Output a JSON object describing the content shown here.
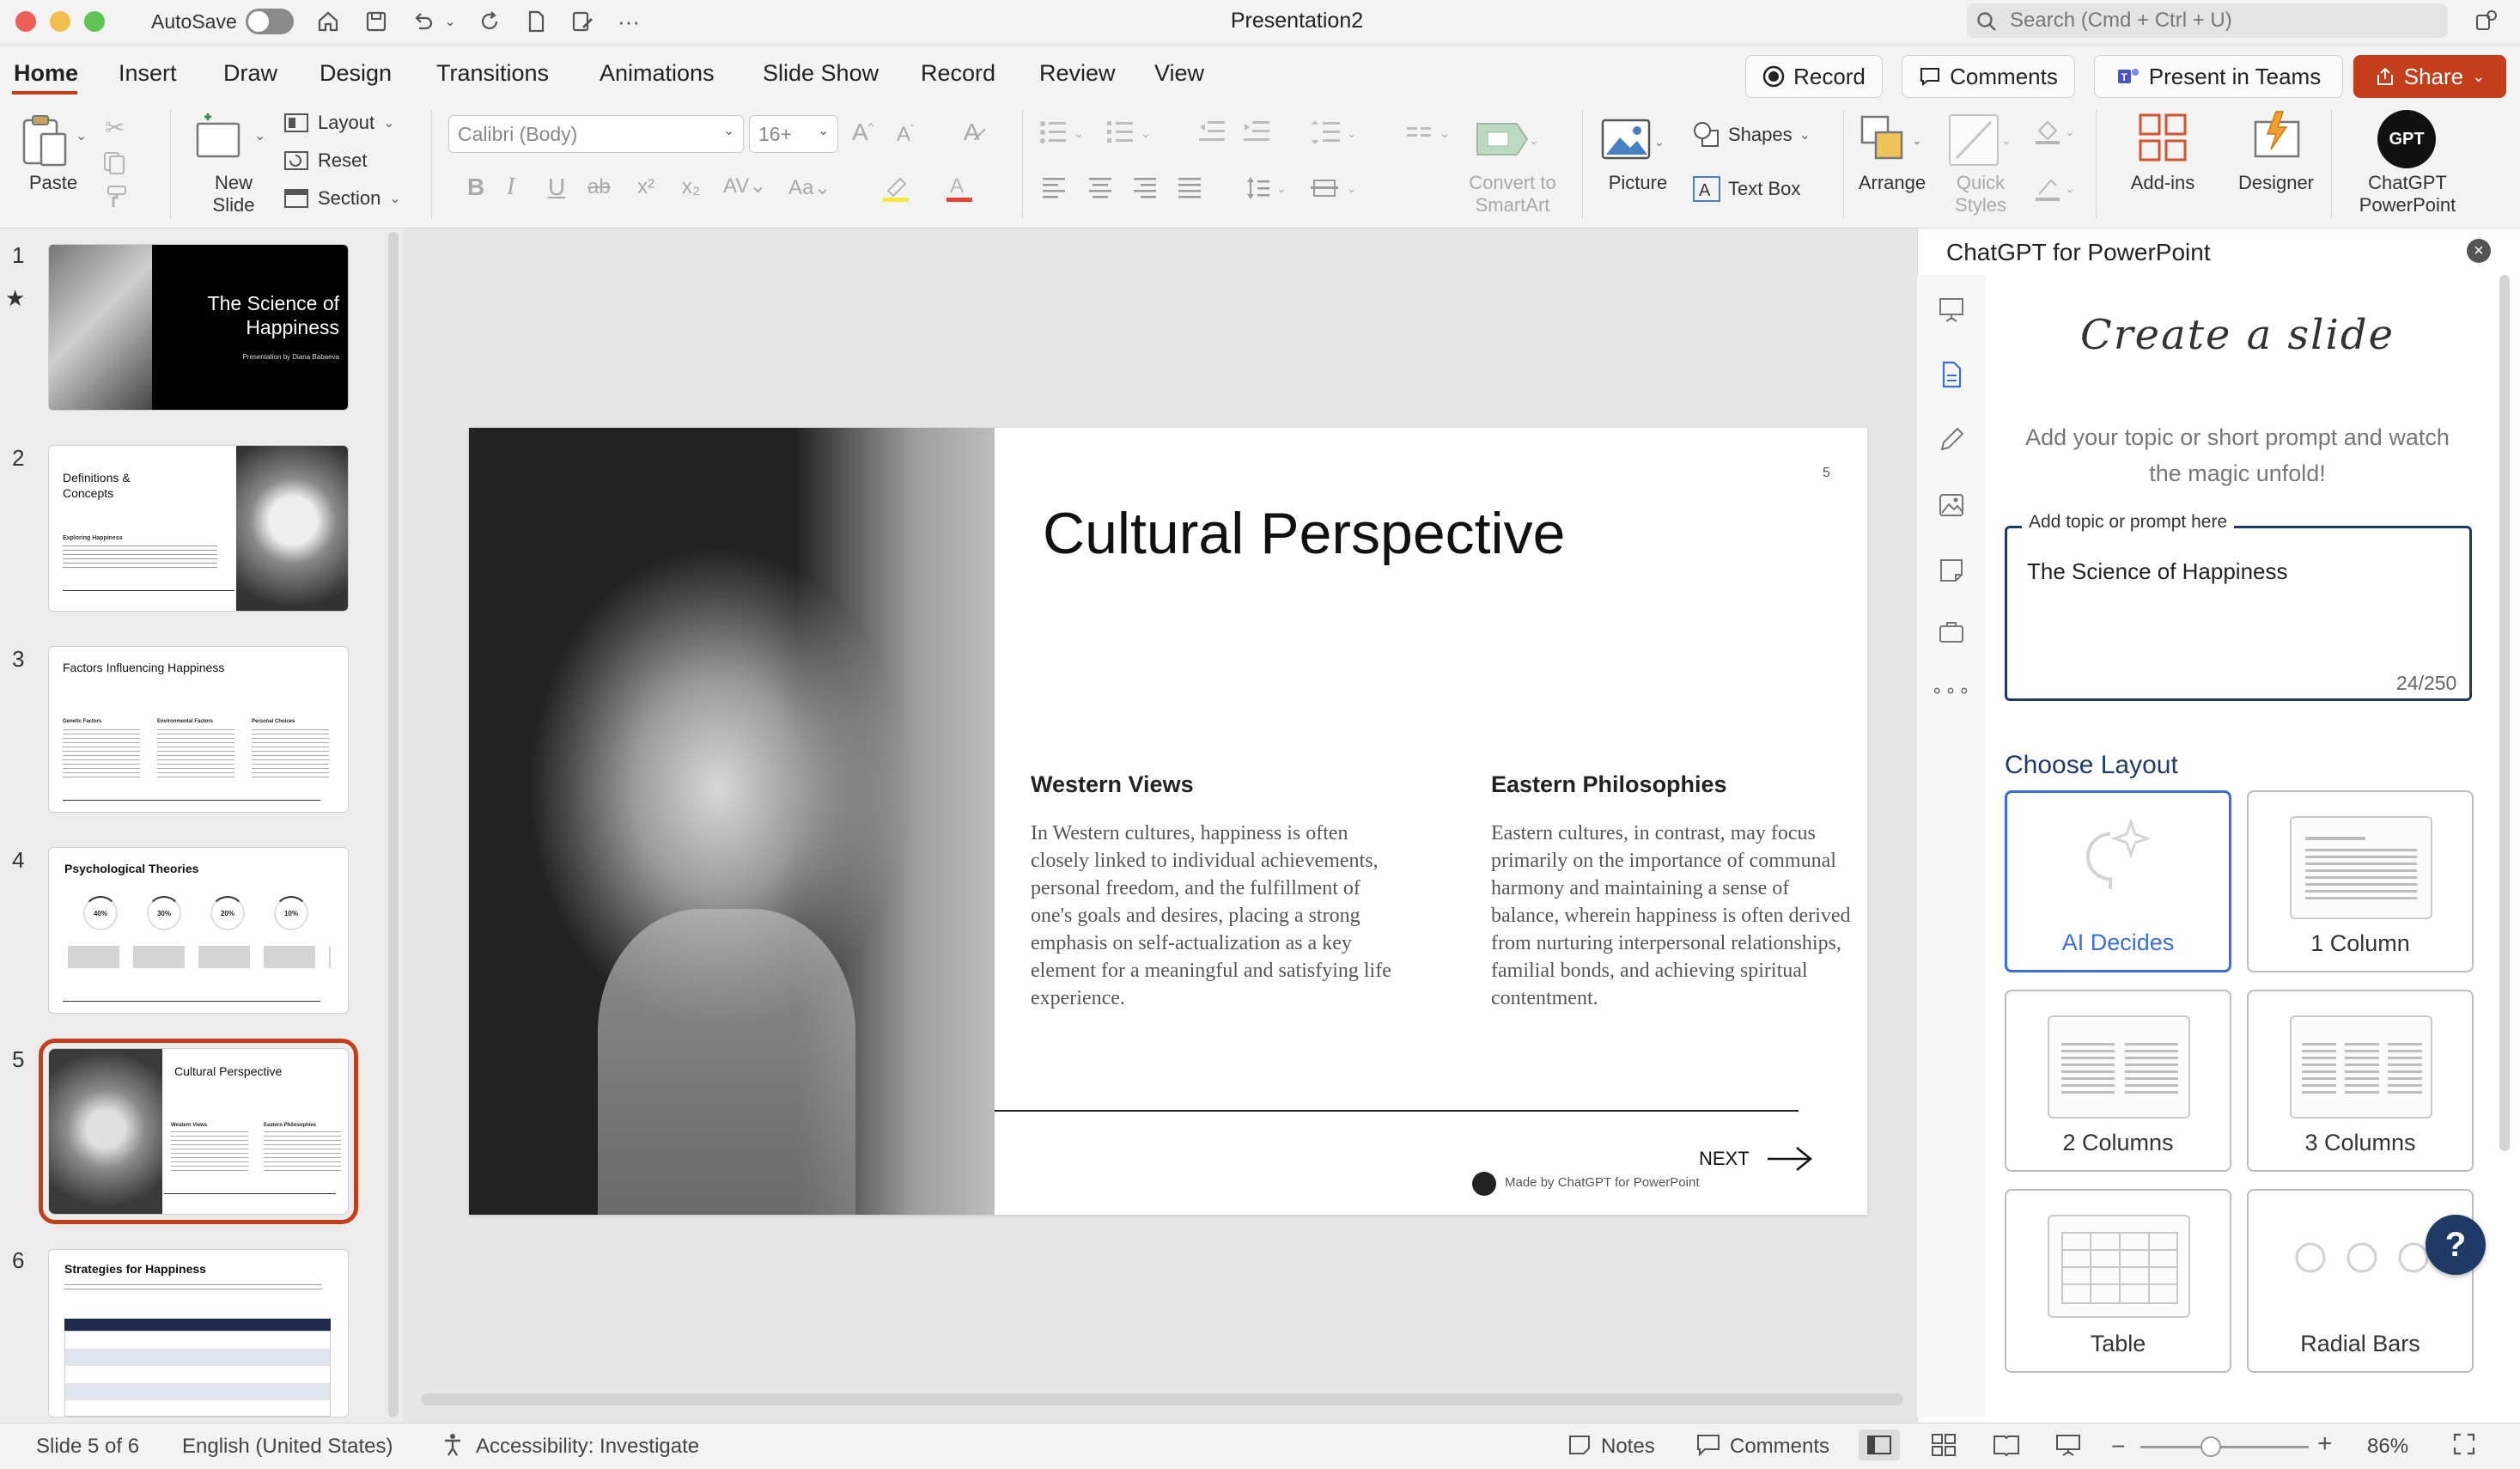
{
  "window": {
    "title": "Presentation2",
    "autosave_label": "AutoSave",
    "search_placeholder": "Search (Cmd + Ctrl + U)"
  },
  "tabs": [
    {
      "label": "Home",
      "active": true
    },
    {
      "label": "Insert"
    },
    {
      "label": "Draw"
    },
    {
      "label": "Design"
    },
    {
      "label": "Transitions"
    },
    {
      "label": "Animations"
    },
    {
      "label": "Slide Show"
    },
    {
      "label": "Record"
    },
    {
      "label": "Review"
    },
    {
      "label": "View"
    }
  ],
  "top_buttons": {
    "record": "Record",
    "comments": "Comments",
    "present_in_teams": "Present in Teams",
    "share": "Share"
  },
  "ribbon": {
    "paste": "Paste",
    "new_slide_line1": "New",
    "new_slide_line2": "Slide",
    "layout": "Layout",
    "reset": "Reset",
    "section": "Section",
    "font_name": "Calibri (Body)",
    "font_size": "16+",
    "convert_line1": "Convert to",
    "convert_line2": "SmartArt",
    "picture": "Picture",
    "shapes": "Shapes",
    "text_box": "Text Box",
    "arrange": "Arrange",
    "quick_styles_line1": "Quick",
    "quick_styles_line2": "Styles",
    "add_ins": "Add-ins",
    "designer": "Designer",
    "chatgpt_line1": "ChatGPT",
    "chatgpt_line2": "PowerPoint",
    "chatgpt_logo": "GPT"
  },
  "thumbnails": [
    {
      "num": "1",
      "title": "The Science of Happiness",
      "subtitle": "Presentation by Diana Babaeva"
    },
    {
      "num": "2",
      "title": "Definitions & Concepts",
      "subtitle": "Exploring Happiness"
    },
    {
      "num": "3",
      "title": "Factors Influencing Happiness",
      "cols": [
        "Genetic Factors",
        "Environmental Factors",
        "Personal Choices"
      ]
    },
    {
      "num": "4",
      "title": "Psychological Theories",
      "pcts": [
        "40%",
        "30%",
        "20%",
        "10%"
      ]
    },
    {
      "num": "5",
      "title": "Cultural Perspective",
      "cols": [
        "Western Views",
        "Eastern Philosophies"
      ]
    },
    {
      "num": "6",
      "title": "Strategies for Happiness"
    }
  ],
  "slide": {
    "number": "5",
    "title": "Cultural Perspective",
    "col1_heading": "Western Views",
    "col1_body": "In Western cultures, happiness is often closely linked to individual achievements, personal freedom, and the fulfillment of one's goals and desires, placing a strong emphasis on self-actualization as a key element for a meaningful and satisfying life experience.",
    "col2_heading": "Eastern Philosophies",
    "col2_body": "Eastern cultures, in contrast, may focus primarily on the importance of communal harmony and maintaining a sense of balance, wherein happiness is often derived from nurturing interpersonal relationships, familial bonds, and achieving spiritual contentment.",
    "next_label": "NEXT",
    "made_by": "Made by ChatGPT for PowerPoint"
  },
  "side_panel": {
    "title": "ChatGPT for PowerPoint",
    "heading": "Create a slide",
    "subtitle": "Add your topic or short prompt and watch the magic unfold!",
    "prompt_label": "Add topic or prompt here",
    "prompt_value": "The Science of Happiness",
    "prompt_count": "24/250",
    "choose_layout": "Choose Layout",
    "layouts": [
      {
        "label": "AI Decides",
        "selected": true
      },
      {
        "label": "1 Column"
      },
      {
        "label": "2 Columns"
      },
      {
        "label": "3 Columns"
      },
      {
        "label": "Table"
      },
      {
        "label": "Radial Bars"
      }
    ],
    "help": "?"
  },
  "statusbar": {
    "slide_info": "Slide 5 of 6",
    "language": "English (United States)",
    "accessibility": "Accessibility: Investigate",
    "notes": "Notes",
    "comments": "Comments",
    "zoom": "86%"
  },
  "colors": {
    "accent": "#c43e1c",
    "panel_blue": "#1f3a66",
    "selected_layout": "#3b6fd6"
  }
}
